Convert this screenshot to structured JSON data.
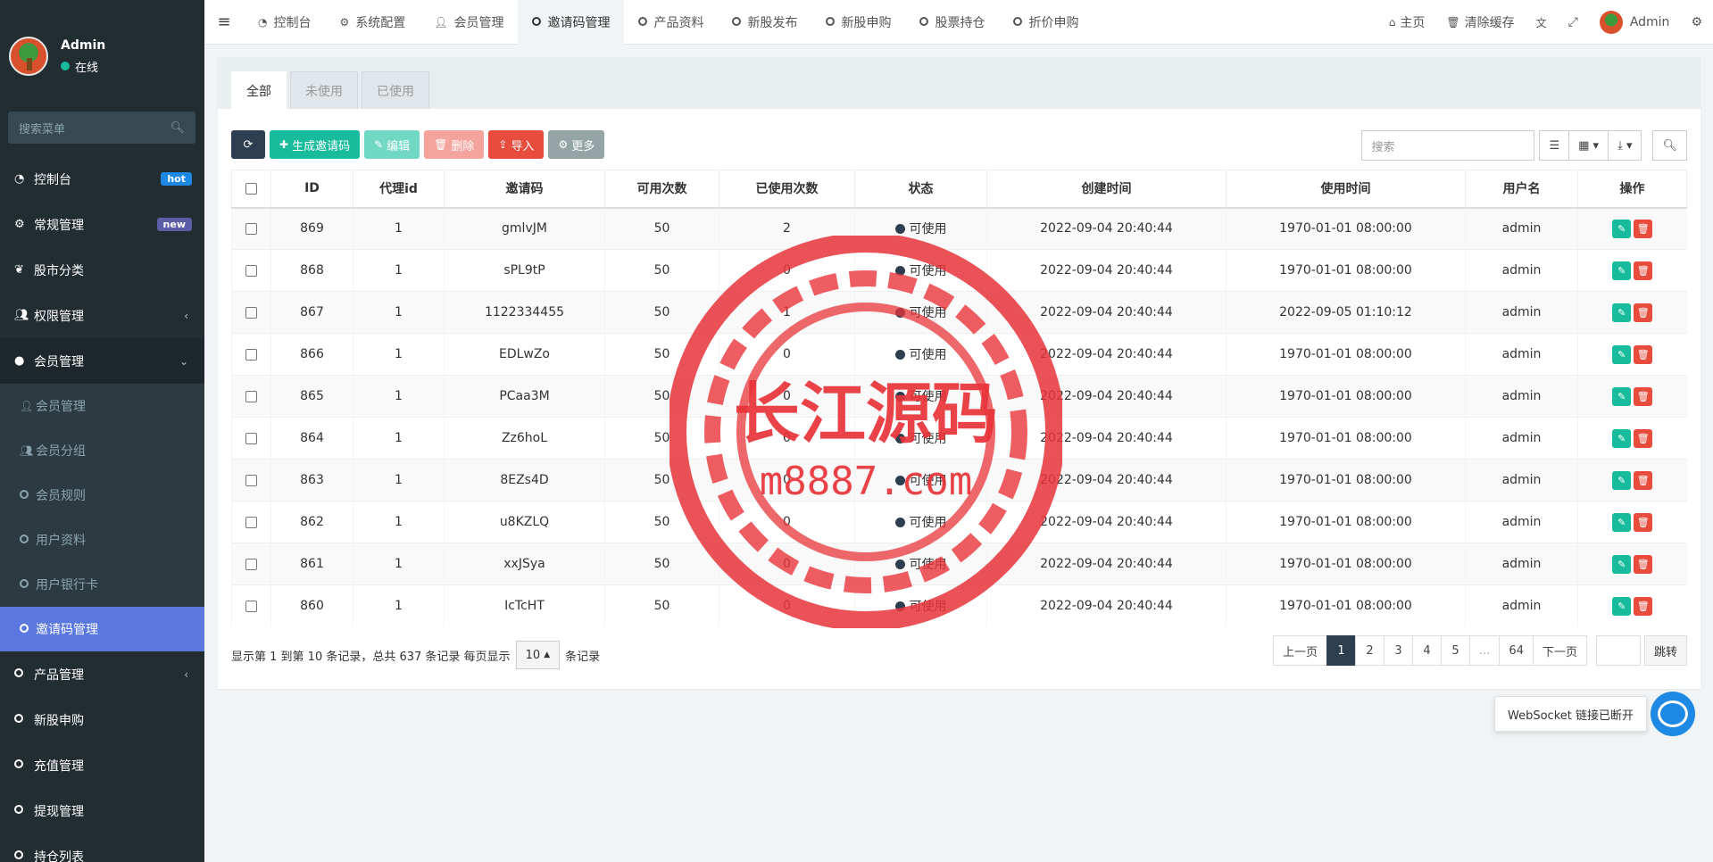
{
  "sidebar": {
    "user_name": "Admin",
    "user_status": "在线",
    "search_placeholder": "搜索菜单",
    "menu": [
      {
        "label": "控制台",
        "badge": "hot"
      },
      {
        "label": "常规管理",
        "badge": "new"
      },
      {
        "label": "股市分类"
      },
      {
        "label": "权限管理"
      },
      {
        "label": "会员管理"
      }
    ],
    "submenu": [
      {
        "label": "会员管理"
      },
      {
        "label": "会员分组"
      },
      {
        "label": "会员规则"
      },
      {
        "label": "用户资料"
      },
      {
        "label": "用户银行卡"
      },
      {
        "label": "邀请码管理"
      }
    ],
    "menu_after": [
      {
        "label": "产品管理"
      },
      {
        "label": "新股申购"
      },
      {
        "label": "充值管理"
      },
      {
        "label": "提现管理"
      },
      {
        "label": "持仓列表"
      }
    ]
  },
  "topbar": {
    "tabs": [
      {
        "label": "控制台"
      },
      {
        "label": "系统配置"
      },
      {
        "label": "会员管理"
      },
      {
        "label": "邀请码管理"
      },
      {
        "label": "产品资料"
      },
      {
        "label": "新股发布"
      },
      {
        "label": "新股申购"
      },
      {
        "label": "股票持仓"
      },
      {
        "label": "折价申购"
      }
    ],
    "home": "主页",
    "clear_cache": "清除缓存",
    "admin": "Admin"
  },
  "panel": {
    "tabs": [
      {
        "label": "全部"
      },
      {
        "label": "未使用"
      },
      {
        "label": "已使用"
      }
    ],
    "toolbar": {
      "generate": "生成邀请码",
      "edit": "编辑",
      "delete": "删除",
      "import": "导入",
      "more": "更多"
    },
    "search_placeholder": "搜索"
  },
  "table": {
    "headers": [
      "ID",
      "代理id",
      "邀请码",
      "可用次数",
      "已使用次数",
      "状态",
      "创建时间",
      "使用时间",
      "用户名",
      "操作"
    ],
    "rows": [
      {
        "id": "869",
        "agent": "1",
        "code": "gmlvJM",
        "avail": "50",
        "used": "2",
        "status": "可使用",
        "created": "2022-09-04 20:40:44",
        "usedat": "1970-01-01 08:00:00",
        "user": "admin"
      },
      {
        "id": "868",
        "agent": "1",
        "code": "sPL9tP",
        "avail": "50",
        "used": "0",
        "status": "可使用",
        "created": "2022-09-04 20:40:44",
        "usedat": "1970-01-01 08:00:00",
        "user": "admin"
      },
      {
        "id": "867",
        "agent": "1",
        "code": "1122334455",
        "avail": "50",
        "used": "1",
        "status": "可使用",
        "created": "2022-09-04 20:40:44",
        "usedat": "2022-09-05 01:10:12",
        "user": "admin"
      },
      {
        "id": "866",
        "agent": "1",
        "code": "EDLwZo",
        "avail": "50",
        "used": "0",
        "status": "可使用",
        "created": "2022-09-04 20:40:44",
        "usedat": "1970-01-01 08:00:00",
        "user": "admin"
      },
      {
        "id": "865",
        "agent": "1",
        "code": "PCaa3M",
        "avail": "50",
        "used": "0",
        "status": "可使用",
        "created": "2022-09-04 20:40:44",
        "usedat": "1970-01-01 08:00:00",
        "user": "admin"
      },
      {
        "id": "864",
        "agent": "1",
        "code": "Zz6hoL",
        "avail": "50",
        "used": "0",
        "status": "可使用",
        "created": "2022-09-04 20:40:44",
        "usedat": "1970-01-01 08:00:00",
        "user": "admin"
      },
      {
        "id": "863",
        "agent": "1",
        "code": "8EZs4D",
        "avail": "50",
        "used": "0",
        "status": "可使用",
        "created": "2022-09-04 20:40:44",
        "usedat": "1970-01-01 08:00:00",
        "user": "admin"
      },
      {
        "id": "862",
        "agent": "1",
        "code": "u8KZLQ",
        "avail": "50",
        "used": "0",
        "status": "可使用",
        "created": "2022-09-04 20:40:44",
        "usedat": "1970-01-01 08:00:00",
        "user": "admin"
      },
      {
        "id": "861",
        "agent": "1",
        "code": "xxJSya",
        "avail": "50",
        "used": "0",
        "status": "可使用",
        "created": "2022-09-04 20:40:44",
        "usedat": "1970-01-01 08:00:00",
        "user": "admin"
      },
      {
        "id": "860",
        "agent": "1",
        "code": "IcTcHT",
        "avail": "50",
        "used": "0",
        "status": "可使用",
        "created": "2022-09-04 20:40:44",
        "usedat": "1970-01-01 08:00:00",
        "user": "admin"
      }
    ]
  },
  "pagination": {
    "info_prefix": "显示第 1 到第 10 条记录，总共 637 条记录 每页显示",
    "page_size": "10",
    "info_suffix": "条记录",
    "prev": "上一页",
    "pages": [
      "1",
      "2",
      "3",
      "4",
      "5",
      "...",
      "64"
    ],
    "next": "下一页",
    "go": "跳转"
  },
  "websocket": "WebSocket 链接已断开",
  "watermark": {
    "title": "长江源码",
    "url": "m8887.com"
  },
  "colors": {
    "sidebar": "#222d32",
    "active": "#5a78e0",
    "primary": "#18bc9c",
    "danger": "#e74c3c",
    "dark": "#2c3e50"
  }
}
